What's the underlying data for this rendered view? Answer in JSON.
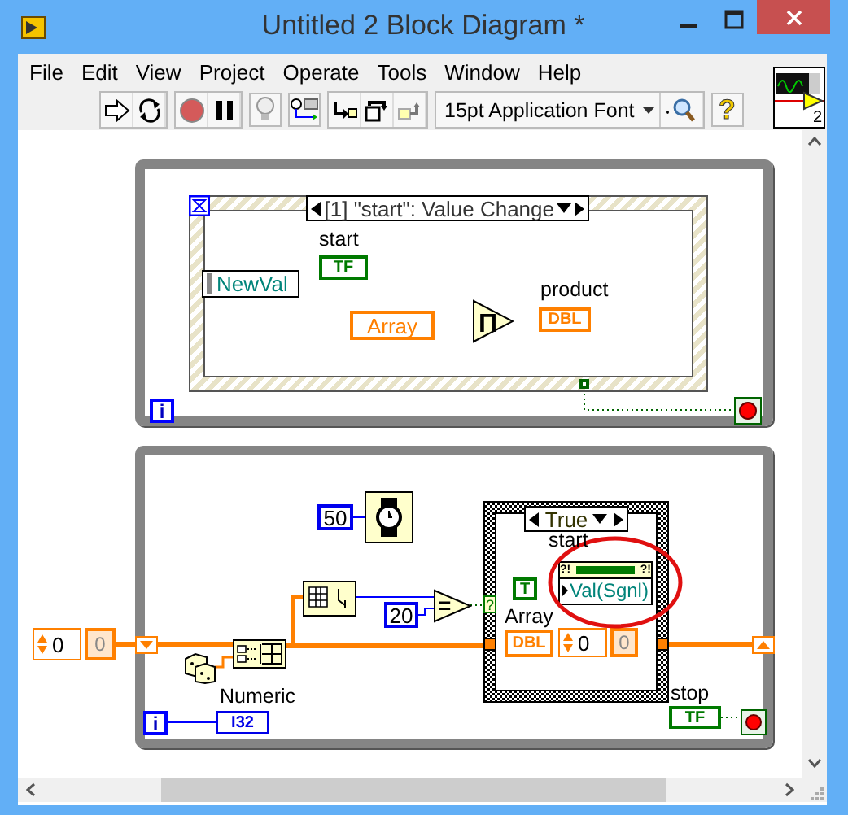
{
  "window": {
    "title": "Untitled 2 Block Diagram *"
  },
  "menu": [
    "File",
    "Edit",
    "View",
    "Project",
    "Operate",
    "Tools",
    "Window",
    "Help"
  ],
  "toolbar": {
    "font": "15pt Application Font",
    "help": "?"
  },
  "vi_icon": {
    "badge": "2"
  },
  "event_loop": {
    "iteration": "i",
    "event_case": "[1] \"start\": Value Change",
    "event_data": "NewVal",
    "start_label": "start",
    "start_terminal": "TF",
    "array_constant": "Array",
    "multiply_symbol": "Π",
    "product_label": "product",
    "product_terminal": "DBL"
  },
  "shift_register_init": {
    "index": "0",
    "element": "0"
  },
  "main_loop": {
    "iteration": "i",
    "wait_ms": "50",
    "count": "20",
    "compare_symbol": "=",
    "selector_terminal": "?",
    "case": "True",
    "start_label": "start",
    "error_in": "?!",
    "error_out": "?!",
    "property": "Val(Sgnl)",
    "true_constant": "T",
    "array_label": "Array",
    "array_terminal": "DBL",
    "array_index": "0",
    "array_element": "0",
    "numeric_label": "Numeric",
    "numeric_terminal": "I32",
    "stop_label": "stop",
    "stop_terminal": "TF"
  }
}
